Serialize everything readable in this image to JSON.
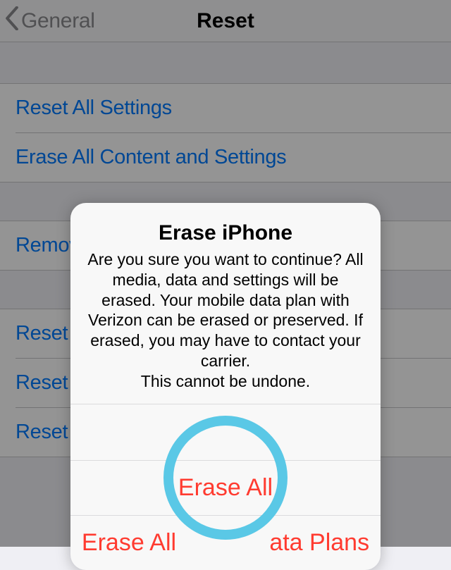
{
  "nav": {
    "back_label": "General",
    "title": "Reset"
  },
  "group1": {
    "row0": "Reset All Settings",
    "row1": "Erase All Content and Settings"
  },
  "group2": {
    "row0": "Remove"
  },
  "group3": {
    "row0": "Reset K",
    "row1": "Reset H",
    "row2": "Reset L"
  },
  "alert": {
    "title": "Erase iPhone",
    "message": "Are you sure you want to continue? All media, data and settings will be erased. Your mobile data plan with Verizon can be erased or preserved. If erased, you may have to contact your carrier.\nThis cannot be undone.",
    "btn1": "Erase All",
    "btn2": "Erase All              ata Plans"
  }
}
